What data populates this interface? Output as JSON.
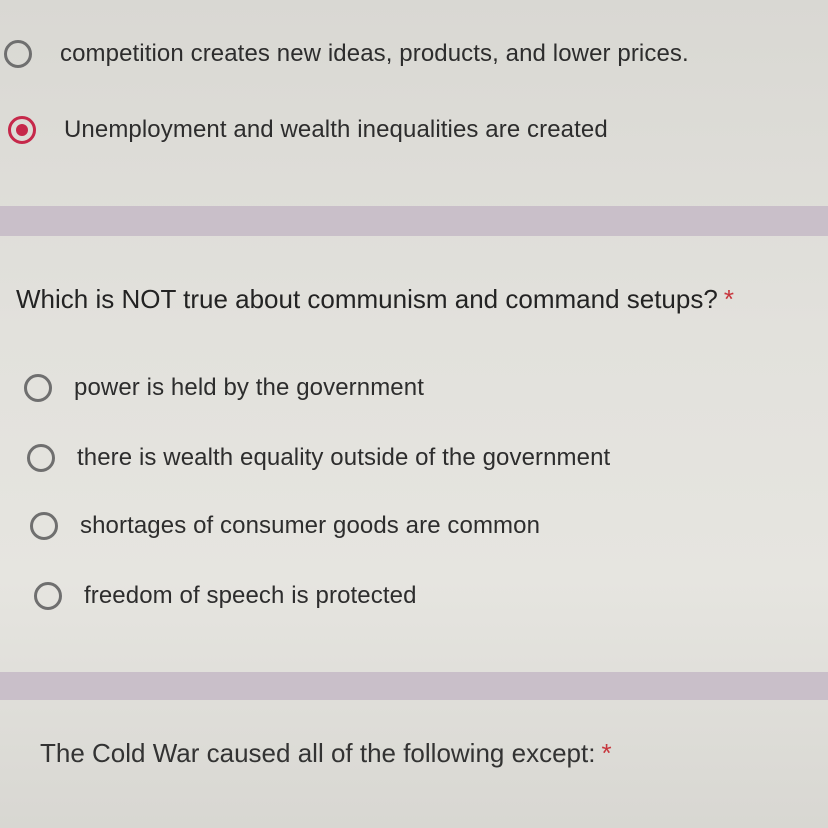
{
  "previous_question": {
    "options": [
      {
        "label": "competition creates new ideas, products, and lower prices.",
        "selected": false
      },
      {
        "label": "Unemployment and wealth inequalities are created",
        "selected": true
      }
    ]
  },
  "question": {
    "title": "Which is NOT true about communism and command setups?",
    "required_marker": "*",
    "options": [
      {
        "label": "power is held by the government",
        "selected": false
      },
      {
        "label": "there is wealth equality outside of the government",
        "selected": false
      },
      {
        "label": "shortages of consumer goods are common",
        "selected": false
      },
      {
        "label": "freedom of speech is protected",
        "selected": false
      }
    ]
  },
  "next_question": {
    "title": "The Cold War caused all of the following except:",
    "required_marker": "*"
  },
  "colors": {
    "selected_radio": "#c6284a",
    "divider": "#c9bfc9",
    "required_asterisk": "#c7363d"
  }
}
